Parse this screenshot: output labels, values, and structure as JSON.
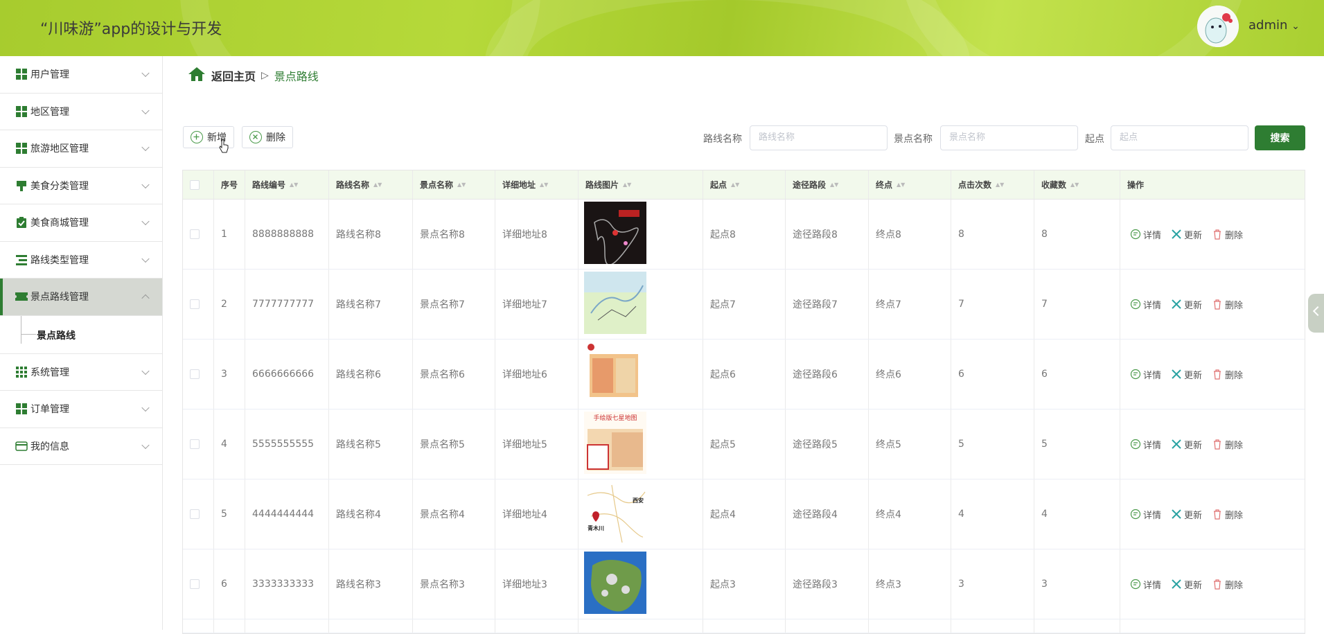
{
  "header": {
    "app_title": "“川味游”app的设计与开发",
    "user": "admin",
    "user_chevron": "⌄"
  },
  "sidebar": {
    "items": [
      {
        "label": "用户管理",
        "icon": "grid-icon"
      },
      {
        "label": "地区管理",
        "icon": "grid-icon"
      },
      {
        "label": "旅游地区管理",
        "icon": "grid-icon"
      },
      {
        "label": "美食分类管理",
        "icon": "flag-icon"
      },
      {
        "label": "美食商城管理",
        "icon": "clipboard-check-icon"
      },
      {
        "label": "路线类型管理",
        "icon": "list-icon"
      },
      {
        "label": "景点路线管理",
        "icon": "ticket-icon",
        "active": true
      },
      {
        "label": "系统管理",
        "icon": "grid9-icon"
      },
      {
        "label": "订单管理",
        "icon": "grid-icon"
      },
      {
        "label": "我的信息",
        "icon": "wallet-icon"
      }
    ],
    "submenu_label": "景点路线"
  },
  "breadcrumb": {
    "home": "返回主页",
    "separator": "▷",
    "current": "景点路线"
  },
  "toolbar": {
    "add_label": "新增",
    "delete_label": "删除"
  },
  "filters": {
    "route_name_label": "路线名称",
    "route_name_placeholder": "路线名称",
    "spot_name_label": "景点名称",
    "spot_name_placeholder": "景点名称",
    "start_label": "起点",
    "start_placeholder": "起点",
    "search_label": "搜索"
  },
  "table": {
    "headers": [
      "序号",
      "路线编号",
      "路线名称",
      "景点名称",
      "详细地址",
      "路线图片",
      "起点",
      "途径路段",
      "终点",
      "点击次数",
      "收藏数",
      "操作"
    ],
    "actions": {
      "detail": "详情",
      "update": "更新",
      "delete": "删除"
    },
    "rows": [
      {
        "idx": "1",
        "code": "8888888888",
        "name": "路线名称8",
        "spot": "景点名称8",
        "addr": "详细地址8",
        "start": "起点8",
        "via": "途径路段8",
        "end": "终点8",
        "clicks": "8",
        "favs": "8"
      },
      {
        "idx": "2",
        "code": "7777777777",
        "name": "路线名称7",
        "spot": "景点名称7",
        "addr": "详细地址7",
        "start": "起点7",
        "via": "途径路段7",
        "end": "终点7",
        "clicks": "7",
        "favs": "7"
      },
      {
        "idx": "3",
        "code": "6666666666",
        "name": "路线名称6",
        "spot": "景点名称6",
        "addr": "详细地址6",
        "start": "起点6",
        "via": "途径路段6",
        "end": "终点6",
        "clicks": "6",
        "favs": "6"
      },
      {
        "idx": "4",
        "code": "5555555555",
        "name": "路线名称5",
        "spot": "景点名称5",
        "addr": "详细地址5",
        "start": "起点5",
        "via": "途径路段5",
        "end": "终点5",
        "clicks": "5",
        "favs": "5"
      },
      {
        "idx": "5",
        "code": "4444444444",
        "name": "路线名称4",
        "spot": "景点名称4",
        "addr": "详细地址4",
        "start": "起点4",
        "via": "途径路段4",
        "end": "终点4",
        "clicks": "4",
        "favs": "4"
      },
      {
        "idx": "6",
        "code": "3333333333",
        "name": "路线名称3",
        "spot": "景点名称3",
        "addr": "详细地址3",
        "start": "起点3",
        "via": "途径路段3",
        "end": "终点3",
        "clicks": "3",
        "favs": "3"
      }
    ],
    "map_labels": {
      "row4_title": "手绘版七星地图",
      "row5_city_a": "西安",
      "row5_city_b": "青木川"
    }
  },
  "colors": {
    "brand_green": "#2e7d32",
    "header_lime": "#a7cc2e",
    "table_header_bg": "#f2f9ec"
  }
}
